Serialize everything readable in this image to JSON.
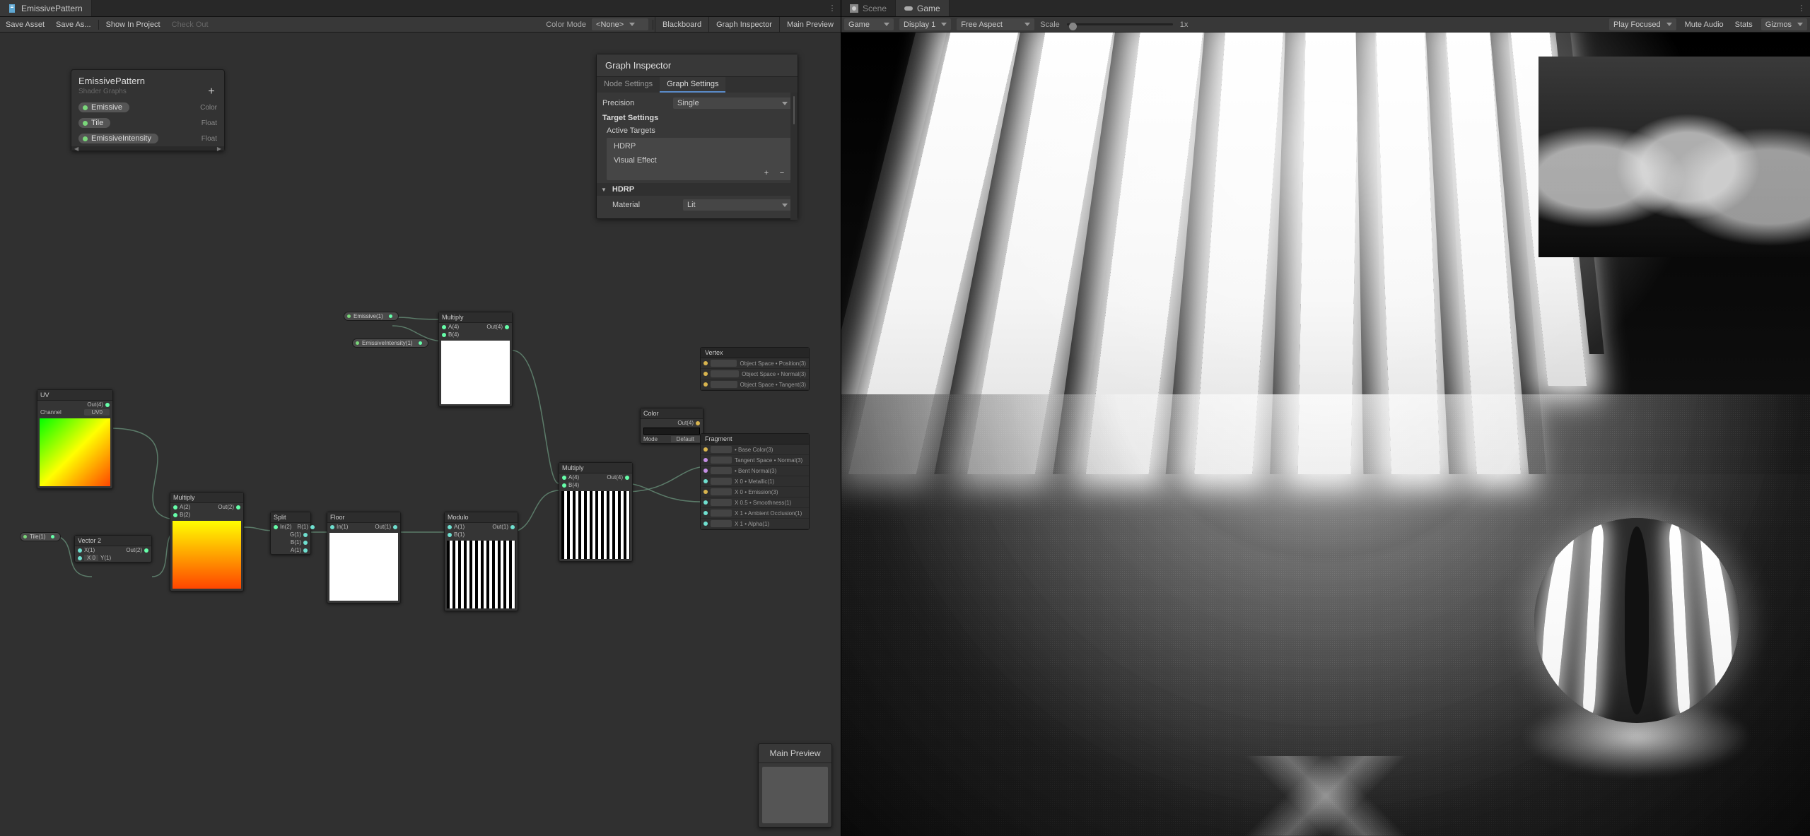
{
  "left": {
    "tab": {
      "title": "EmissivePattern"
    },
    "toolbar": {
      "save_asset": "Save Asset",
      "save_as": "Save As...",
      "show_in_project": "Show In Project",
      "check_out": "Check Out",
      "color_mode_label": "Color Mode",
      "color_mode_value": "<None>",
      "blackboard": "Blackboard",
      "graph_inspector": "Graph Inspector",
      "main_preview": "Main Preview"
    },
    "blackboard": {
      "title": "EmissivePattern",
      "subtitle": "Shader Graphs",
      "props": [
        {
          "name": "Emissive",
          "type": "Color"
        },
        {
          "name": "Tile",
          "type": "Float"
        },
        {
          "name": "EmissiveIntensity",
          "type": "Float"
        }
      ]
    },
    "inspector": {
      "title": "Graph Inspector",
      "tab_node": "Node Settings",
      "tab_graph": "Graph Settings",
      "precision_label": "Precision",
      "precision_value": "Single",
      "target_settings_label": "Target Settings",
      "active_targets_label": "Active Targets",
      "targets": [
        "HDRP",
        "Visual Effect"
      ],
      "hdrp_section": "HDRP",
      "material_label": "Material",
      "material_value": "Lit"
    },
    "main_preview_title": "Main Preview",
    "pillnodes": {
      "emissive": "Emissive(1)",
      "emissive_intensity": "EmissiveIntensity(1)",
      "tile": "Tile(1)"
    },
    "nodes": {
      "uv": {
        "title": "UV",
        "out": "Out(4)",
        "channel_label": "Channel",
        "channel_value": "UV0"
      },
      "vector2": {
        "title": "Vector 2",
        "x": "X(1)",
        "y": "Y(1)",
        "out": "Out(2)"
      },
      "multiply1": {
        "title": "Multiply",
        "a": "A(4)",
        "b": "B(4)",
        "out": "Out(4)"
      },
      "multiply2": {
        "title": "Multiply",
        "a": "A(2)",
        "b": "B(2)",
        "out": "Out(2)"
      },
      "split": {
        "title": "Split",
        "in": "In(2)",
        "r": "R(1)",
        "g": "G(1)",
        "b": "B(1)",
        "a": "A(1)"
      },
      "floor": {
        "title": "Floor",
        "in": "In(1)",
        "out": "Out(1)"
      },
      "modulo": {
        "title": "Modulo",
        "a": "A(1)",
        "b": "B(1)",
        "out": "Out(1)"
      },
      "multiply3": {
        "title": "Multiply",
        "a": "A(4)",
        "b": "B(4)",
        "out": "Out(4)"
      },
      "color": {
        "title": "Color",
        "out": "Out(4)",
        "mode_label": "Mode",
        "mode_value": "Default"
      },
      "vertex": {
        "title": "Vertex",
        "rows": [
          "Object Space • Position(3)",
          "Object Space • Normal(3)",
          "Object Space • Tangent(3)"
        ]
      },
      "fragment": {
        "title": "Fragment",
        "rows": [
          "• Base Color(3)",
          "Tangent Space • Normal(3)",
          "• Bent Normal(3)",
          "X 0 • Metallic(1)",
          "X 0 • Emission(3)",
          "X 0.5 • Smoothness(1)",
          "X 1 • Ambient Occlusion(1)",
          "X 1 • Alpha(1)"
        ]
      }
    }
  },
  "right": {
    "tabs": {
      "scene": "Scene",
      "game": "Game"
    },
    "toolbar": {
      "game_dd": "Game",
      "display": "Display 1",
      "aspect": "Free Aspect",
      "scale_label": "Scale",
      "scale_value": "1x",
      "play_focused": "Play Focused",
      "mute_audio": "Mute Audio",
      "stats": "Stats",
      "gizmos": "Gizmos"
    }
  }
}
